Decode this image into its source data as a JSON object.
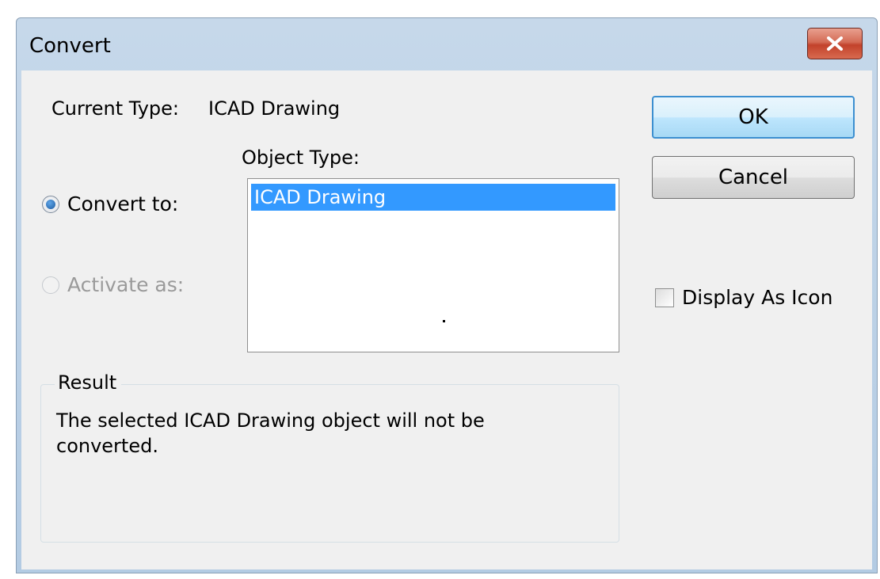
{
  "window": {
    "title": "Convert",
    "close_icon": "close-icon"
  },
  "current_type": {
    "label": "Current Type:",
    "value": "ICAD Drawing"
  },
  "object_type": {
    "label": "Object Type:",
    "items": [
      "ICAD Drawing"
    ],
    "selected": "ICAD Drawing"
  },
  "options": {
    "convert_to": {
      "label": "Convert to:",
      "checked": true,
      "enabled": true
    },
    "activate_as": {
      "label": "Activate as:",
      "checked": false,
      "enabled": false
    }
  },
  "result": {
    "label": "Result",
    "text": "The selected ICAD Drawing object will not be converted."
  },
  "buttons": {
    "ok": "OK",
    "cancel": "Cancel"
  },
  "display_as_icon": {
    "label": "Display As Icon",
    "checked": false
  },
  "colors": {
    "selection": "#3399ff",
    "close_button": "#c2422b",
    "default_button_border": "#3c8fd0"
  }
}
